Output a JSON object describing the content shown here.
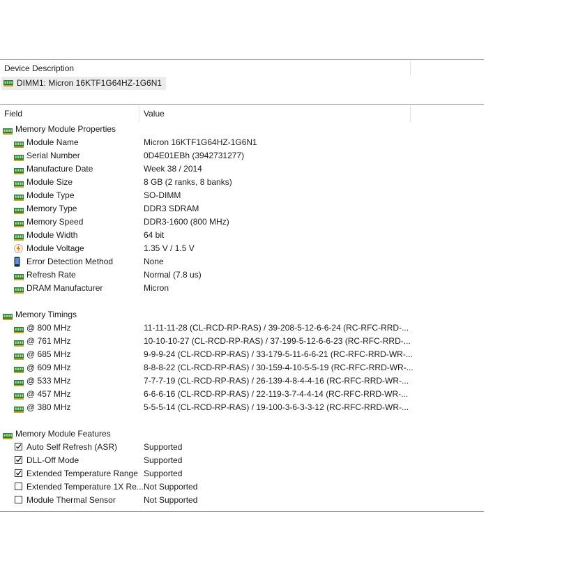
{
  "device": {
    "header_label": "Device Description",
    "selected_item": "DIMM1: Micron 16KTF1G64HZ-1G6N1",
    "icon": "ram-module-icon"
  },
  "columns": {
    "field": "Field",
    "value": "Value"
  },
  "colors": {
    "ram_green": "#2e7d32",
    "selection": "#ececec",
    "grid_line": "#9a9a9a"
  },
  "groups": {
    "properties": {
      "title": "Memory Module Properties",
      "rows": [
        {
          "field": "Module Name",
          "value": "Micron 16KTF1G64HZ-1G6N1",
          "icon": "ram-icon"
        },
        {
          "field": "Serial Number",
          "value": "0D4E01EBh (3942731277)",
          "icon": "ram-icon"
        },
        {
          "field": "Manufacture Date",
          "value": "Week 38 / 2014",
          "icon": "ram-icon"
        },
        {
          "field": "Module Size",
          "value": "8 GB (2 ranks, 8 banks)",
          "icon": "ram-icon"
        },
        {
          "field": "Module Type",
          "value": "SO-DIMM",
          "icon": "ram-icon"
        },
        {
          "field": "Memory Type",
          "value": "DDR3 SDRAM",
          "icon": "ram-icon"
        },
        {
          "field": "Memory Speed",
          "value": "DDR3-1600 (800 MHz)",
          "icon": "ram-icon"
        },
        {
          "field": "Module Width",
          "value": "64 bit",
          "icon": "ram-icon"
        },
        {
          "field": "Module Voltage",
          "value": "1.35 V / 1.5 V",
          "icon": "voltage-icon"
        },
        {
          "field": "Error Detection Method",
          "value": "None",
          "icon": "phone-icon"
        },
        {
          "field": "Refresh Rate",
          "value": "Normal (7.8 us)",
          "icon": "ram-icon"
        },
        {
          "field": "DRAM Manufacturer",
          "value": "Micron",
          "icon": "ram-icon"
        }
      ]
    },
    "timings": {
      "title": "Memory Timings",
      "rows": [
        {
          "field": "@ 800 MHz",
          "value": "11-11-11-28  (CL-RCD-RP-RAS) / 39-208-5-12-6-6-24  (RC-RFC-RRD-..."
        },
        {
          "field": "@ 761 MHz",
          "value": "10-10-10-27  (CL-RCD-RP-RAS) / 37-199-5-12-6-6-23  (RC-RFC-RRD-..."
        },
        {
          "field": "@ 685 MHz",
          "value": "9-9-9-24  (CL-RCD-RP-RAS) / 33-179-5-11-6-6-21  (RC-RFC-RRD-WR-..."
        },
        {
          "field": "@ 609 MHz",
          "value": "8-8-8-22  (CL-RCD-RP-RAS) / 30-159-4-10-5-5-19  (RC-RFC-RRD-WR-..."
        },
        {
          "field": "@ 533 MHz",
          "value": "7-7-7-19  (CL-RCD-RP-RAS) / 26-139-4-8-4-4-16  (RC-RFC-RRD-WR-..."
        },
        {
          "field": "@ 457 MHz",
          "value": "6-6-6-16  (CL-RCD-RP-RAS) / 22-119-3-7-4-4-14  (RC-RFC-RRD-WR-..."
        },
        {
          "field": "@ 380 MHz",
          "value": "5-5-5-14  (CL-RCD-RP-RAS) / 19-100-3-6-3-3-12  (RC-RFC-RRD-WR-..."
        }
      ]
    },
    "features": {
      "title": "Memory Module Features",
      "rows": [
        {
          "field": "Auto Self Refresh (ASR)",
          "value": "Supported",
          "checked": true
        },
        {
          "field": "DLL-Off Mode",
          "value": "Supported",
          "checked": true
        },
        {
          "field": "Extended Temperature Range",
          "value": "Supported",
          "checked": true
        },
        {
          "field": "Extended Temperature 1X Re...",
          "value": "Not Supported",
          "checked": false
        },
        {
          "field": "Module Thermal Sensor",
          "value": "Not Supported",
          "checked": false
        }
      ]
    }
  }
}
